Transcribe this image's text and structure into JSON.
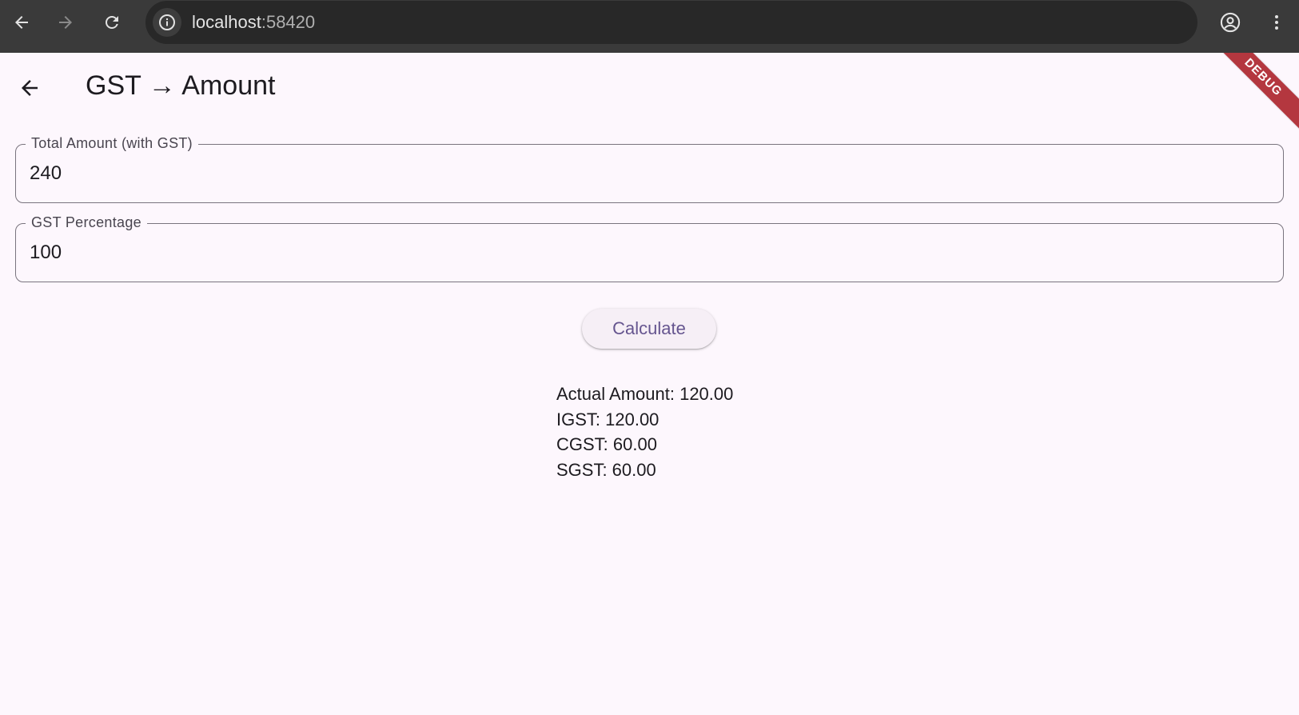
{
  "browser": {
    "url_host": "localhost",
    "url_port": ":58420",
    "icons": {
      "back": "arrow-left-icon",
      "forward": "arrow-right-icon",
      "reload": "reload-icon",
      "site_info": "info-icon",
      "bookmark": "star-icon",
      "profile": "account-circle-icon",
      "menu": "more-vert-icon"
    }
  },
  "app": {
    "title": "GST → Amount",
    "back_icon": "arrow-back-icon",
    "debug_banner": "DEBUG",
    "fields": {
      "total_amount": {
        "label": "Total Amount (with GST)",
        "value": "240"
      },
      "gst_percentage": {
        "label": "GST Percentage",
        "value": "100"
      }
    },
    "calculate_label": "Calculate",
    "results": {
      "actual_amount": "Actual Amount: 120.00",
      "igst": "IGST: 120.00",
      "cgst": "CGST: 60.00",
      "sgst": "SGST: 60.00"
    },
    "colors": {
      "background": "#fdf7fd",
      "primary": "#65558f",
      "outline": "#79747e",
      "debug": "#b4373f"
    }
  }
}
